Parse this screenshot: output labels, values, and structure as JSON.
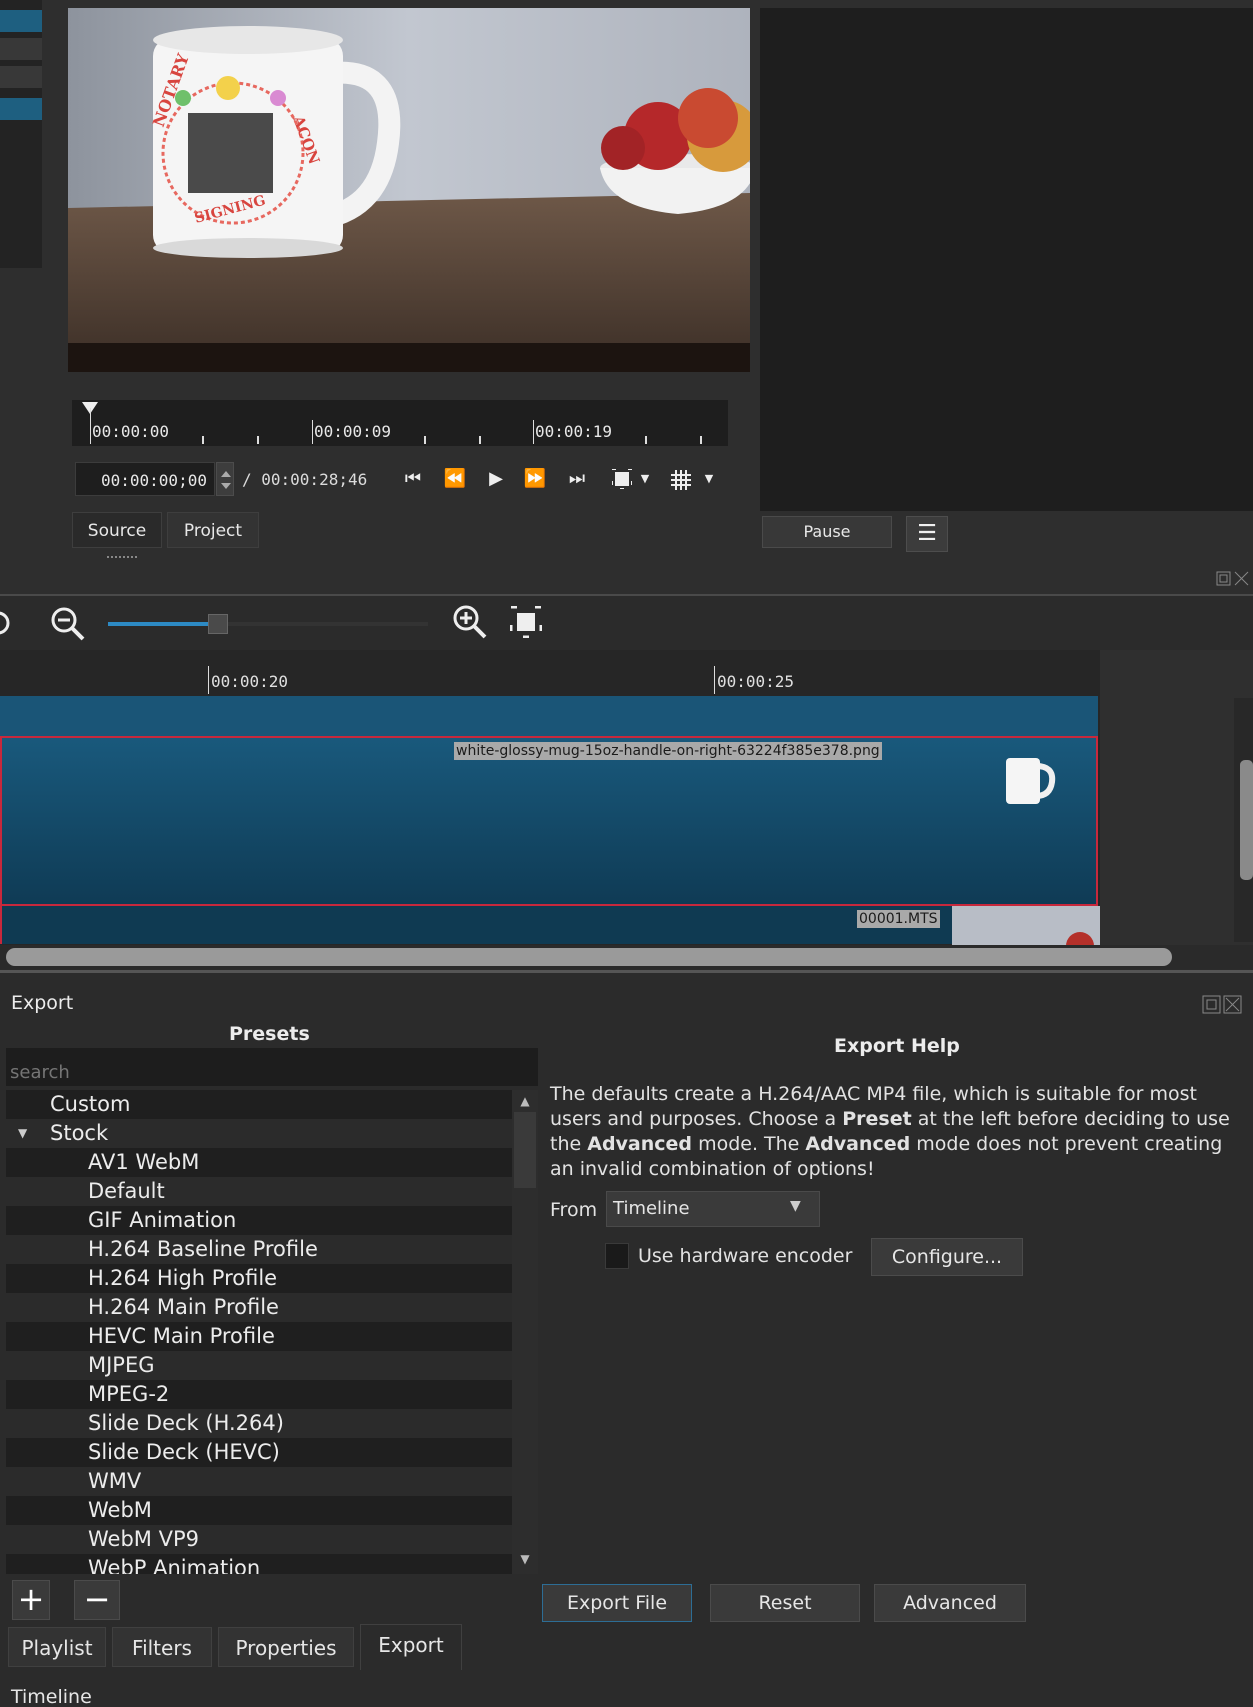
{
  "player": {
    "ruler_labels": [
      "00:00:00",
      "00:00:09",
      "00:00:19"
    ],
    "timecode": "00:00:00;00",
    "duration": "/ 00:00:28;46",
    "tabs": [
      "Source",
      "Project"
    ],
    "pause_label": "Pause",
    "menu_glyph": "☰"
  },
  "mug_text": {
    "arc_left": "NOTARY",
    "arc_bottom": "SIGNING",
    "arc_right": "ACON"
  },
  "timeline": {
    "ruler_labels": [
      "00:00:20",
      "00:00:25"
    ],
    "clip_mug_label": "white-glossy-mug-15oz-handle-on-right-63224f385e378.png",
    "clip_mts_label": "00001.MTS"
  },
  "export": {
    "title": "Export",
    "presets_title": "Presets",
    "search_placeholder": "search",
    "presets": [
      {
        "label": "Custom",
        "level": 0
      },
      {
        "label": "Stock",
        "level": 0,
        "expanded": true
      },
      {
        "label": "AV1 WebM",
        "level": 1
      },
      {
        "label": "Default",
        "level": 1
      },
      {
        "label": "GIF Animation",
        "level": 1
      },
      {
        "label": "H.264 Baseline Profile",
        "level": 1
      },
      {
        "label": "H.264 High Profile",
        "level": 1
      },
      {
        "label": "H.264 Main Profile",
        "level": 1
      },
      {
        "label": "HEVC Main Profile",
        "level": 1
      },
      {
        "label": "MJPEG",
        "level": 1
      },
      {
        "label": "MPEG-2",
        "level": 1
      },
      {
        "label": "Slide Deck (H.264)",
        "level": 1
      },
      {
        "label": "Slide Deck (HEVC)",
        "level": 1
      },
      {
        "label": "WMV",
        "level": 1
      },
      {
        "label": "WebM",
        "level": 1
      },
      {
        "label": "WebM VP9",
        "level": 1
      },
      {
        "label": "WebP Animation",
        "level": 1
      }
    ],
    "help_title": "Export Help",
    "help_segments": [
      {
        "t": "The defaults create a H.264/AAC MP4 file, which is suitable for most users and purposes. Choose a ",
        "b": false
      },
      {
        "t": "Preset",
        "b": true
      },
      {
        "t": " at the left before deciding to use the ",
        "b": false
      },
      {
        "t": "Advanced",
        "b": true
      },
      {
        "t": " mode. The ",
        "b": false
      },
      {
        "t": "Advanced",
        "b": true
      },
      {
        "t": " mode does not prevent creating an invalid combination of options!",
        "b": false
      }
    ],
    "from_label": "From",
    "from_value": "Timeline",
    "hw_label": "Use hardware encoder",
    "configure_label": "Configure...",
    "add_glyph": "+",
    "remove_glyph": "−",
    "export_file_label": "Export File",
    "reset_label": "Reset",
    "advanced_label": "Advanced"
  },
  "bottom_tabs": [
    "Playlist",
    "Filters",
    "Properties",
    "Export"
  ],
  "bottom_panel_title": "Timeline",
  "colors": {
    "accent": "#2d8ac4",
    "clip_border": "#c8283c",
    "track_blue": "#1a5577"
  }
}
